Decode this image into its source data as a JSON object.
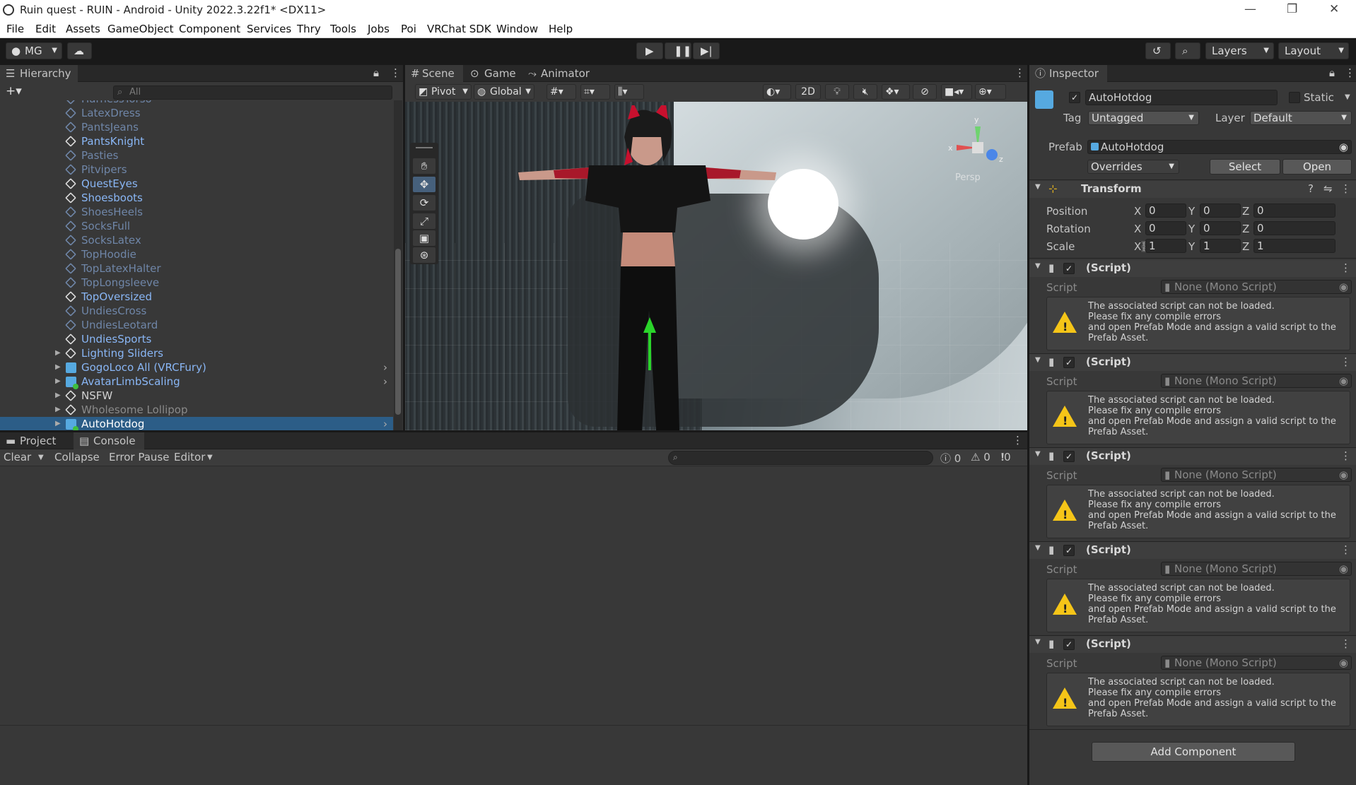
{
  "window": {
    "title": "Ruin quest - RUIN - Android - Unity 2022.3.22f1* <DX11>"
  },
  "menu": [
    "File",
    "Edit",
    "Assets",
    "GameObject",
    "Component",
    "Services",
    "Thry",
    "Tools",
    "Jobs",
    "Poi",
    "VRChat SDK",
    "Window",
    "Help"
  ],
  "toolbar": {
    "account": "MG",
    "layers": "Layers",
    "layout": "Layout"
  },
  "hierarchy": {
    "tab": "Hierarchy",
    "search_placeholder": "All",
    "items": [
      {
        "label": "HarnessTorso",
        "style": "dim"
      },
      {
        "label": "LatexDress",
        "style": "dim"
      },
      {
        "label": "PantsJeans",
        "style": "dim"
      },
      {
        "label": "PantsKnight",
        "style": "bright"
      },
      {
        "label": "Pasties",
        "style": "dim"
      },
      {
        "label": "Pitvipers",
        "style": "dim"
      },
      {
        "label": "QuestEyes",
        "style": "bright"
      },
      {
        "label": "Shoesboots",
        "style": "bright"
      },
      {
        "label": "ShoesHeels",
        "style": "dim"
      },
      {
        "label": "SocksFull",
        "style": "dim"
      },
      {
        "label": "SocksLatex",
        "style": "dim"
      },
      {
        "label": "TopHoodie",
        "style": "dim"
      },
      {
        "label": "TopLatexHalter",
        "style": "dim"
      },
      {
        "label": "TopLongsleeve",
        "style": "dim"
      },
      {
        "label": "TopOversized",
        "style": "bright"
      },
      {
        "label": "UndiesCross",
        "style": "dim"
      },
      {
        "label": "UndiesLeotard",
        "style": "dim"
      },
      {
        "label": "UndiesSports",
        "style": "bright"
      },
      {
        "label": "Lighting Sliders",
        "style": "bright"
      },
      {
        "label": "GogoLoco All (VRCFury)",
        "style": "bright"
      },
      {
        "label": "AvatarLimbScaling",
        "style": "bright"
      },
      {
        "label": "NSFW",
        "style": "white"
      },
      {
        "label": "Wholesome Lollipop",
        "style": "grey"
      },
      {
        "label": "AutoHotdog",
        "style": "sel"
      }
    ]
  },
  "scene": {
    "tabs": [
      "Scene",
      "Game",
      "Animator"
    ],
    "pivot": "Pivot",
    "global": "Global",
    "mode_2d": "2D",
    "persp": "Persp"
  },
  "console": {
    "tabs": [
      "Project",
      "Console"
    ],
    "clear": "Clear",
    "collapse": "Collapse",
    "error_pause": "Error Pause",
    "editor": "Editor",
    "count_logs": "0",
    "count_warnings": "0",
    "count_errors": "0"
  },
  "inspector": {
    "tab": "Inspector",
    "object_name": "AutoHotdog",
    "static_label": "Static",
    "tag_label": "Tag",
    "tag_value": "Untagged",
    "layer_label": "Layer",
    "layer_value": "Default",
    "prefab_label": "Prefab",
    "prefab_value": "AutoHotdog",
    "overrides": "Overrides",
    "select": "Select",
    "open": "Open",
    "transform": {
      "title": "Transform",
      "position_label": "Position",
      "rotation_label": "Rotation",
      "scale_label": "Scale",
      "position": {
        "x": "0",
        "y": "0",
        "z": "0"
      },
      "rotation": {
        "x": "0",
        "y": "0",
        "z": "0"
      },
      "scale": {
        "x": "1",
        "y": "1",
        "z": "1"
      }
    },
    "script_components": [
      {
        "title": "(Script)",
        "script_label": "Script",
        "script_value": "None (Mono Script)",
        "warning": "The associated script can not be loaded.\nPlease fix any compile errors\nand open Prefab Mode and assign a valid script to the\nPrefab Asset."
      },
      {
        "title": "(Script)",
        "script_label": "Script",
        "script_value": "None (Mono Script)",
        "warning": "The associated script can not be loaded.\nPlease fix any compile errors\nand open Prefab Mode and assign a valid script to the\nPrefab Asset."
      },
      {
        "title": "(Script)",
        "script_label": "Script",
        "script_value": "None (Mono Script)",
        "warning": "The associated script can not be loaded.\nPlease fix any compile errors\nand open Prefab Mode and assign a valid script to the\nPrefab Asset."
      },
      {
        "title": "(Script)",
        "script_label": "Script",
        "script_value": "None (Mono Script)",
        "warning": "The associated script can not be loaded.\nPlease fix any compile errors\nand open Prefab Mode and assign a valid script to the\nPrefab Asset."
      },
      {
        "title": "(Script)",
        "script_label": "Script",
        "script_value": "None (Mono Script)",
        "warning": "The associated script can not be loaded.\nPlease fix any compile errors\nand open Prefab Mode and assign a valid script to the\nPrefab Asset."
      }
    ],
    "add_component": "Add Component"
  },
  "colors": {
    "selection": "#2c5d87",
    "prefab_blue": "#56a9e0",
    "warning_yellow": "#f5c518"
  }
}
